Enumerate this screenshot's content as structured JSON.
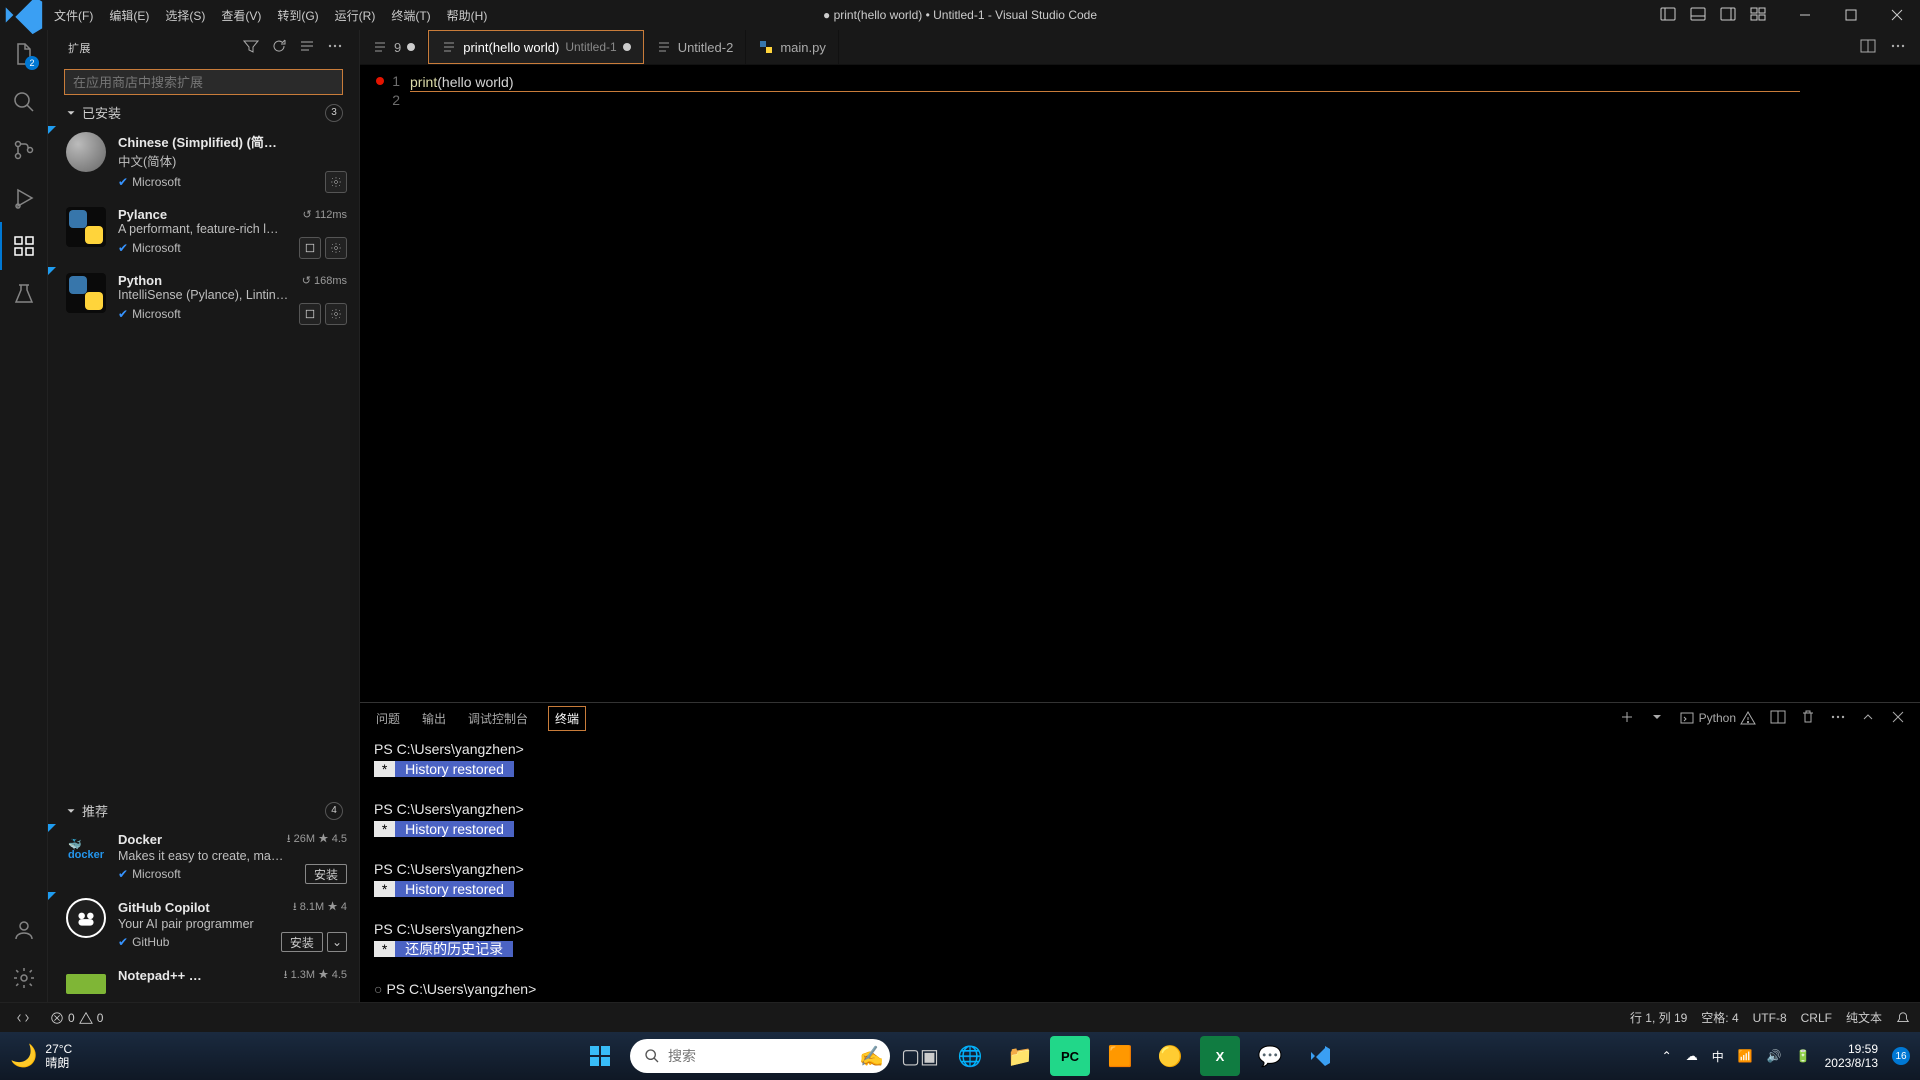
{
  "title": "● print(hello world) • Untitled-1 - Visual Studio Code",
  "menu": [
    "文件(F)",
    "编辑(E)",
    "选择(S)",
    "查看(V)",
    "转到(G)",
    "运行(R)",
    "终端(T)",
    "帮助(H)"
  ],
  "activity_badge": "2",
  "sidebar": {
    "title": "扩展",
    "search_placeholder": "在应用商店中搜索扩展",
    "installed": {
      "label": "已安装",
      "count": "3"
    },
    "recommended": {
      "label": "推荐",
      "count": "4"
    },
    "installed_items": [
      {
        "name": "Chinese (Simplified) (简…",
        "desc": "中文(简体)",
        "publisher": "Microsoft",
        "verified": true,
        "meta": "",
        "actions": [
          "gear"
        ],
        "iconClass": "world",
        "triangle": true
      },
      {
        "name": "Pylance",
        "desc": "A performant, feature-rich l…",
        "publisher": "Microsoft",
        "verified": true,
        "meta": "↺ 112ms",
        "actions": [
          "sq",
          "gear"
        ],
        "iconClass": "python"
      },
      {
        "name": "Python",
        "desc": "IntelliSense (Pylance), Lintin…",
        "publisher": "Microsoft",
        "verified": true,
        "meta": "↺ 168ms",
        "actions": [
          "sq",
          "gear"
        ],
        "iconClass": "python",
        "triangle": true
      }
    ],
    "recommended_items": [
      {
        "name": "Docker",
        "desc": "Makes it easy to create, ma…",
        "publisher": "Microsoft",
        "verified": true,
        "meta": "⭳ 26M  ★ 4.5",
        "actions": [
          "install"
        ],
        "iconClass": "docker",
        "triangle": true
      },
      {
        "name": "GitHub Copilot",
        "desc": "Your AI pair programmer",
        "publisher": "GitHub",
        "verified": true,
        "meta": "⭳ 8.1M  ★ 4",
        "actions": [
          "install",
          "chev"
        ],
        "iconClass": "copilot",
        "triangle": true
      },
      {
        "name": "Notepad++ …",
        "desc": "",
        "publisher": "",
        "verified": false,
        "meta": "⭳ 1.3M  ★ 4.5",
        "actions": [],
        "iconClass": "npp"
      }
    ],
    "install_label": "安装"
  },
  "tabs": [
    {
      "label": "9",
      "dirty": true,
      "icon": "text"
    },
    {
      "label": "print(hello world)",
      "secondary": "Untitled-1",
      "dirty": true,
      "active": true,
      "highlight": true,
      "icon": "text"
    },
    {
      "label": "Untitled-2",
      "icon": "text"
    },
    {
      "label": "main.py",
      "icon": "py"
    }
  ],
  "editor": {
    "lines": [
      {
        "num": "1",
        "content_html": "<span class='func'>print</span><span class='paren'>(</span><span class='plain'>hello world</span><span class='paren'>)</span>",
        "bp": true
      },
      {
        "num": "2",
        "content_html": ""
      }
    ]
  },
  "panel": {
    "tabs": [
      "问题",
      "输出",
      "调试控制台",
      "终端"
    ],
    "active_tab": "终端",
    "kind": "Python",
    "lines": [
      {
        "type": "prompt",
        "text": "PS C:\\Users\\yangzhen>"
      },
      {
        "type": "hist",
        "text": "History restored"
      },
      {
        "type": "blank"
      },
      {
        "type": "prompt",
        "text": "PS C:\\Users\\yangzhen>"
      },
      {
        "type": "hist",
        "text": "History restored"
      },
      {
        "type": "blank"
      },
      {
        "type": "prompt",
        "text": "PS C:\\Users\\yangzhen>"
      },
      {
        "type": "hist",
        "text": "History restored"
      },
      {
        "type": "blank"
      },
      {
        "type": "prompt",
        "text": "PS C:\\Users\\yangzhen>"
      },
      {
        "type": "hist",
        "text": "还原的历史记录"
      },
      {
        "type": "blank"
      },
      {
        "type": "prompt",
        "text": "PS C:\\Users\\yangzhen>",
        "cursor": true
      }
    ]
  },
  "status": {
    "errors": "0",
    "warnings": "0",
    "pos": "行 1, 列 19",
    "spaces": "空格: 4",
    "enc": "UTF-8",
    "eol": "CRLF",
    "lang": "纯文本"
  },
  "taskbar": {
    "temp": "27°C",
    "weather": "晴朗",
    "search_placeholder": "搜索",
    "time": "19:59",
    "date": "2023/8/13",
    "ime": "中",
    "badge": "16"
  }
}
